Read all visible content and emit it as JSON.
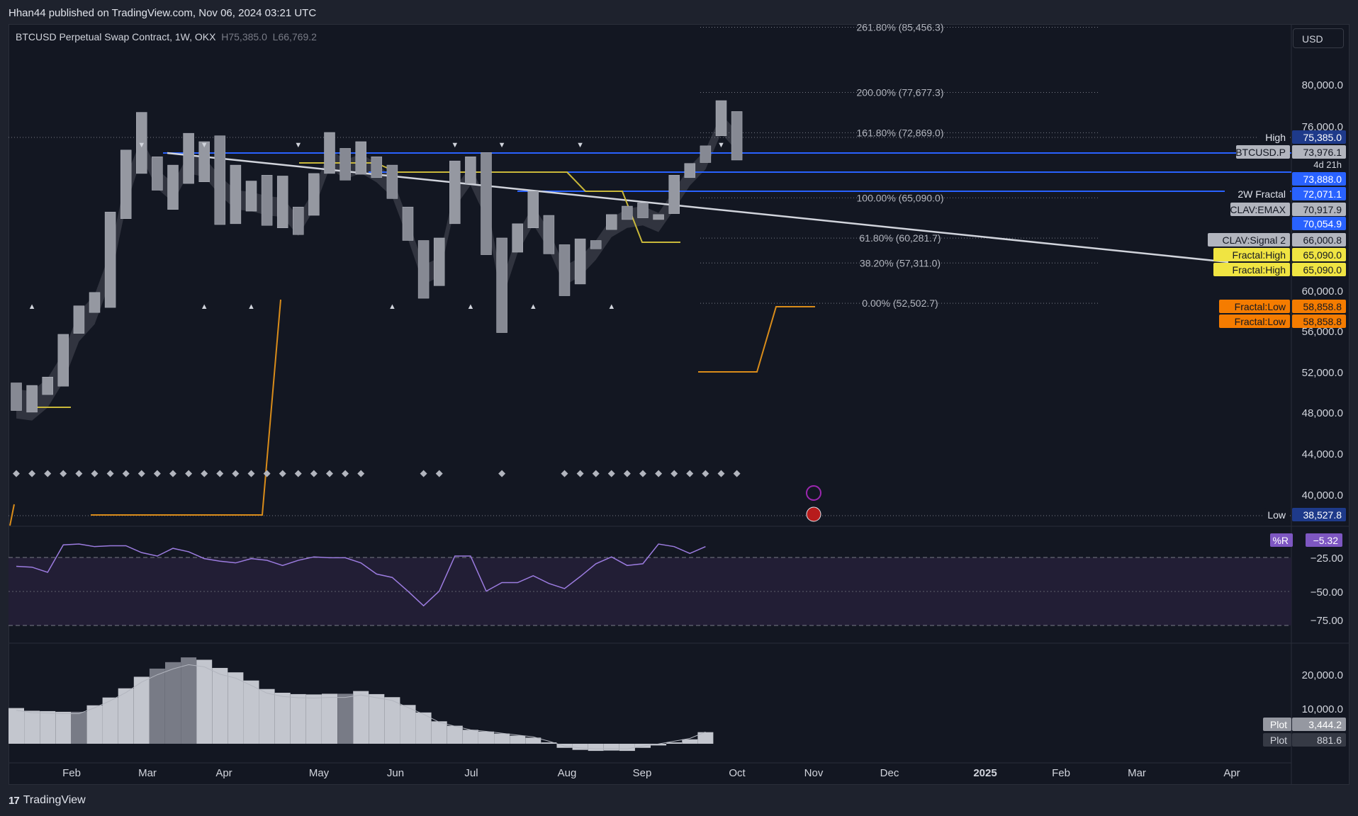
{
  "header": {
    "published": "Hhan44 published on TradingView.com, Nov 06, 2024 03:21 UTC"
  },
  "legend": {
    "symbol": "BTCUSD Perpetual Swap Contract, 1W, OKX",
    "high_prefix": "H",
    "high": "75,385.0",
    "low_prefix": "L",
    "low": "66,769.2"
  },
  "currency_button": "USD",
  "footer": {
    "brand": "TradingView",
    "logo": "tradingview-logo"
  },
  "colors": {
    "background": "#131722",
    "candle": "#9598a1",
    "blue_line": "#2962ff",
    "trendline": "#d1d4dc",
    "yellow_line": "#c9b83a",
    "orange_line": "#d98c1a",
    "williams_r": "#9c7ce0",
    "fractal": "#f0e442",
    "fractal_low": "#f57c00"
  },
  "chart_data": [
    {
      "type": "candlestick",
      "title": "BTCUSD Perpetual Swap Contract, 1W, OKX",
      "x_months": [
        "Feb",
        "Mar",
        "Apr",
        "May",
        "Jun",
        "Jul",
        "Aug",
        "Sep",
        "Oct",
        "Nov",
        "Dec",
        "2025",
        "Feb",
        "Mar",
        "Apr"
      ],
      "y_ticks": [
        "80,000.0",
        "76,000.0",
        "60,000.0",
        "56,000.0",
        "52,000.0",
        "48,000.0",
        "44,000.0",
        "40,000.0"
      ],
      "ylim": [
        37000,
        88000
      ],
      "candles": [
        {
          "o": 43000,
          "c": 39700
        },
        {
          "o": 39500,
          "c": 42700
        },
        {
          "o": 41600,
          "c": 43700
        },
        {
          "o": 42600,
          "c": 48800
        },
        {
          "o": 48900,
          "c": 52200
        },
        {
          "o": 51400,
          "c": 53800
        },
        {
          "o": 52000,
          "c": 63400
        },
        {
          "o": 62600,
          "c": 70800
        },
        {
          "o": 68000,
          "c": 75300
        },
        {
          "o": 70000,
          "c": 66000
        },
        {
          "o": 63700,
          "c": 69000
        },
        {
          "o": 66800,
          "c": 72800
        },
        {
          "o": 67000,
          "c": 71800
        },
        {
          "o": 72500,
          "c": 61900
        },
        {
          "o": 62000,
          "c": 69000
        },
        {
          "o": 63500,
          "c": 67100
        },
        {
          "o": 67800,
          "c": 61800
        },
        {
          "o": 61500,
          "c": 67700
        },
        {
          "o": 64000,
          "c": 60700
        },
        {
          "o": 63000,
          "c": 68000
        },
        {
          "o": 68000,
          "c": 72900
        },
        {
          "o": 71000,
          "c": 67200
        },
        {
          "o": 67900,
          "c": 71800
        },
        {
          "o": 70000,
          "c": 67500
        },
        {
          "o": 69000,
          "c": 65000
        },
        {
          "o": 64000,
          "c": 60000
        },
        {
          "o": 60000,
          "c": 53100
        },
        {
          "o": 54600,
          "c": 60300
        },
        {
          "o": 62000,
          "c": 69500
        },
        {
          "o": 66800,
          "c": 70000
        },
        {
          "o": 70500,
          "c": 58300
        },
        {
          "o": 60300,
          "c": 49000
        },
        {
          "o": 58600,
          "c": 62000
        },
        {
          "o": 61500,
          "c": 65900
        },
        {
          "o": 63000,
          "c": 58400
        },
        {
          "o": 59500,
          "c": 53400
        },
        {
          "o": 54800,
          "c": 60200
        },
        {
          "o": 60000,
          "c": 59000
        },
        {
          "o": 61300,
          "c": 63100
        },
        {
          "o": 64100,
          "c": 62500
        },
        {
          "o": 64500,
          "c": 62700
        },
        {
          "o": 62500,
          "c": 63100
        },
        {
          "o": 63200,
          "c": 67800
        },
        {
          "o": 67500,
          "c": 69200
        },
        {
          "o": 71300,
          "c": 69300
        },
        {
          "o": 72500,
          "c": 76700
        },
        {
          "o": 75400,
          "c": 69600
        }
      ],
      "price_labels": [
        {
          "name": "High",
          "value": "75,385.0"
        },
        {
          "name": "BTCUSD.P",
          "value": "73,976.1",
          "sub": "4d 21h"
        },
        {
          "name": "",
          "value": "73,888.0"
        },
        {
          "name": "2W Fractal",
          "value": "72,071.1"
        },
        {
          "name": "CLAV:EMAX",
          "value": "70,917.9"
        },
        {
          "name": "",
          "value": "70,054.9"
        },
        {
          "name": "CLAV:Signal 2",
          "value": "66,000.8"
        },
        {
          "name": "Fractal:High",
          "value": "65,090.0"
        },
        {
          "name": "Fractal:High",
          "value": "65,090.0"
        },
        {
          "name": "Fractal:Low",
          "value": "58,858.8"
        },
        {
          "name": "Fractal:Low",
          "value": "58,858.8"
        },
        {
          "name": "Low",
          "value": "38,527.8"
        }
      ],
      "fib_levels": [
        {
          "label": "261.80% (85,456.3)",
          "value": 85456.3
        },
        {
          "label": "200.00% (77,677.3)",
          "value": 77677.3
        },
        {
          "label": "161.80% (72,869.0)",
          "value": 72869.0
        },
        {
          "label": "100.00% (65,090.0)",
          "value": 65090.0
        },
        {
          "label": "61.80% (60,281.7)",
          "value": 60281.7
        },
        {
          "label": "38.20% (57,311.0)",
          "value": 57311.0
        },
        {
          "label": "0.00% (52,502.7)",
          "value": 52502.7
        }
      ]
    },
    {
      "type": "line",
      "series": [
        {
          "name": "%R"
        }
      ],
      "y_ticks": [
        "−25.00",
        "−50.00",
        "−75.00"
      ],
      "current_value": "−5.32",
      "ylim": [
        -100,
        0
      ],
      "values": [
        -31,
        -32,
        -38,
        -6,
        -5,
        -8,
        -7,
        -7,
        -15,
        -19,
        -10,
        -14,
        -22,
        -25,
        -27,
        -22,
        -24,
        -30,
        -24,
        -20,
        -21,
        -21,
        -27,
        -40,
        -44,
        -60,
        -77,
        -60,
        -19,
        -19,
        -60,
        -50,
        -50,
        -42,
        -51,
        -57,
        -43,
        -28,
        -20,
        -30,
        -28,
        -5,
        -8,
        -16,
        -8
      ]
    },
    {
      "type": "bar",
      "y_ticks": [
        "20,000.0",
        "10,000.0"
      ],
      "ylim": [
        -3000,
        27000
      ],
      "series": [
        {
          "name": "Plot",
          "value_label": "3,444.2"
        },
        {
          "name": "Plot",
          "value_label": "881.6"
        }
      ],
      "values": [
        10500,
        9700,
        9600,
        9400,
        9400,
        11300,
        13600,
        16300,
        19700,
        22100,
        24000,
        25400,
        24700,
        22300,
        21000,
        18600,
        16100,
        15000,
        14600,
        14500,
        14700,
        14700,
        15500,
        14600,
        13700,
        11400,
        9200,
        6600,
        5300,
        4100,
        3600,
        3000,
        2400,
        1800,
        400,
        -1200,
        -1800,
        -2100,
        -2000,
        -2100,
        -1200,
        -500,
        400,
        1300,
        3400
      ]
    }
  ]
}
